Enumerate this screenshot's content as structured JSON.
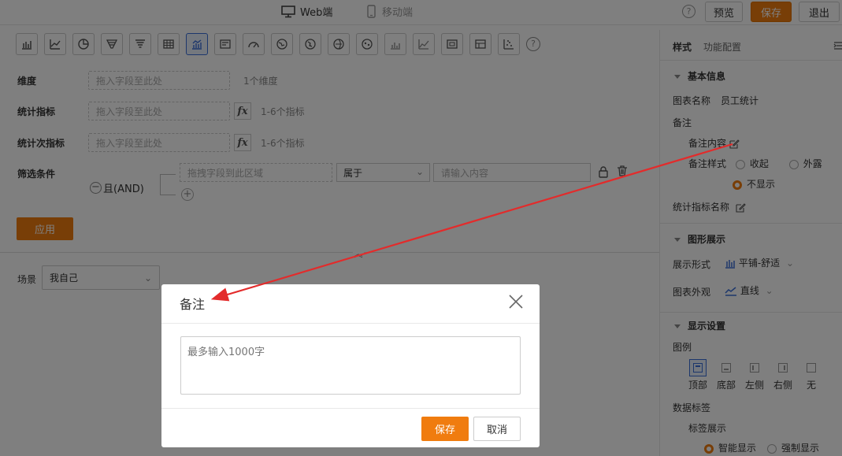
{
  "topbar": {
    "tab_web": "Web端",
    "tab_mobile": "移动端",
    "help": "?",
    "preview_label": "预览",
    "save_label": "保存",
    "exit_label": "退出"
  },
  "editor": {
    "chart_types": [
      "bar-chart",
      "line-chart",
      "pie-chart",
      "funnel-chart",
      "funnel-chart-2",
      "table",
      "combo-chart",
      "card",
      "gauge",
      "map-1",
      "map-2",
      "map-3",
      "map-4",
      "bar-chart-2",
      "line-chart-2",
      "cross-table",
      "detail-table",
      "scatter"
    ],
    "active_chart_index": 6,
    "help": "?",
    "dimension_label": "维度",
    "dimension_placeholder": "拖入字段至此处",
    "dimension_hint": "1个维度",
    "metric_label": "统计指标",
    "metric_placeholder": "拖入字段至此处",
    "metric_hint": "1-6个指标",
    "sub_metric_label": "统计次指标",
    "sub_metric_placeholder": "拖入字段至此处",
    "sub_metric_hint": "1-6个指标",
    "fx": "fx",
    "filter_label": "筛选条件",
    "and_label": "且(AND)",
    "filter_field_placeholder": "拖拽字段到此区域",
    "filter_op": "属于",
    "filter_value_placeholder": "请输入内容",
    "apply_label": "应用",
    "scene_label": "场景",
    "scene_value": "我自己"
  },
  "panel": {
    "tab_style": "样式",
    "tab_function": "功能配置",
    "section_basic": "基本信息",
    "chart_name_label": "图表名称",
    "chart_name_value": "员工统计",
    "note_label": "备注",
    "note_content_label": "备注内容",
    "note_style_label": "备注样式",
    "note_style_options": [
      "收起",
      "外露",
      "不显示"
    ],
    "metric_name_label": "统计指标名称",
    "section_graph": "图形展示",
    "display_form_label": "展示形式",
    "display_form_value": "平铺-舒适",
    "appearance_label": "图表外观",
    "appearance_value": "直线",
    "section_display": "显示设置",
    "legend_label": "图例",
    "legend_options": [
      "顶部",
      "底部",
      "左侧",
      "右侧",
      "无"
    ],
    "data_label_label": "数据标签",
    "label_display_label": "标签展示",
    "label_display_options": [
      "智能显示",
      "强制显示"
    ]
  },
  "dialog": {
    "title": "备注",
    "textarea_placeholder": "最多输入1000字",
    "save_label": "保存",
    "cancel_label": "取消"
  },
  "colors": {
    "accent": "#f07c0f",
    "active_blue": "#3a6fd8",
    "annotation_arrow": "#e32b2b"
  }
}
